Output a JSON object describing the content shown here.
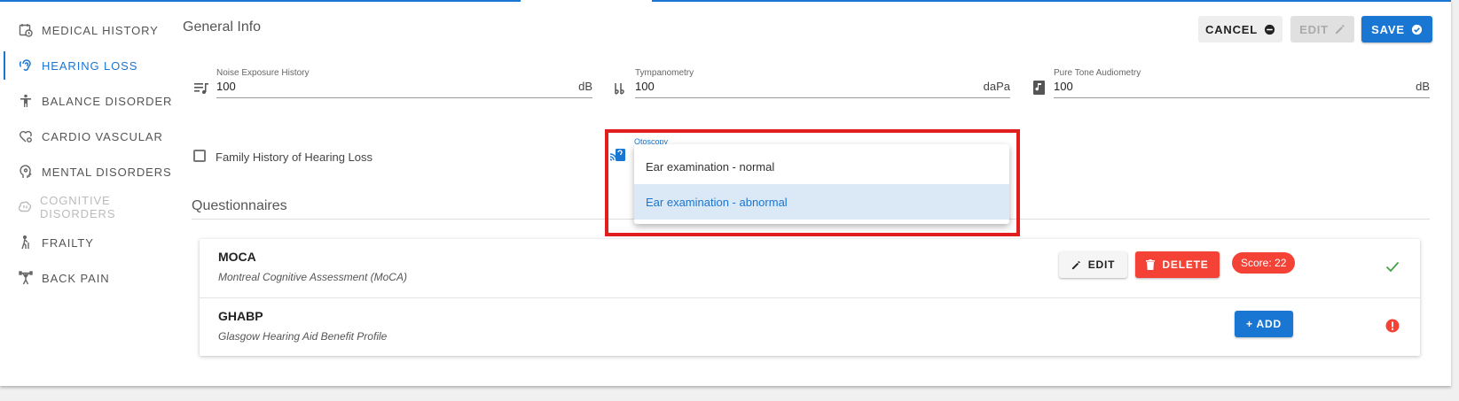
{
  "sidebar": {
    "items": [
      {
        "label": "MEDICAL HISTORY",
        "icon": "calendar-clock-icon",
        "state": "normal"
      },
      {
        "label": "HEARING LOSS",
        "icon": "ear-icon",
        "state": "active"
      },
      {
        "label": "BALANCE DISORDER",
        "icon": "person-standing-icon",
        "state": "normal"
      },
      {
        "label": "CARDIO VASCULAR",
        "icon": "heart-gear-icon",
        "state": "normal"
      },
      {
        "label": "MENTAL DISORDERS",
        "icon": "head-icon",
        "state": "normal"
      },
      {
        "label": "COGNITIVE DISORDERS",
        "icon": "brain-icon",
        "state": "disabled"
      },
      {
        "label": "FRAILTY",
        "icon": "walking-cane-icon",
        "state": "normal"
      },
      {
        "label": "BACK PAIN",
        "icon": "weightlifter-icon",
        "state": "normal"
      }
    ]
  },
  "header": {
    "title": "General Info",
    "cancel_label": "CANCEL",
    "edit_label": "EDIT",
    "save_label": "SAVE"
  },
  "fields": {
    "noise": {
      "label": "Noise Exposure History",
      "value": "100",
      "unit": "dB",
      "icon": "music-list-icon"
    },
    "tympanometry": {
      "label": "Tympanometry",
      "value": "100",
      "unit": "daPa",
      "icon": "double-flat-icon"
    },
    "pure_tone": {
      "label": "Pure Tone Audiometry",
      "value": "100",
      "unit": "dB",
      "icon": "music-book-icon"
    }
  },
  "family_history": {
    "label": "Family History of Hearing Loss",
    "checked": false
  },
  "otoscopy": {
    "label": "Otoscopy",
    "icon": "ear-hearing-icon",
    "options": [
      "Ear examination - normal",
      "Ear examination - abnormal"
    ],
    "highlighted_index": 1
  },
  "questionnaires": {
    "title": "Questionnaires",
    "items": [
      {
        "title": "MOCA",
        "subtitle": "Montreal Cognitive Assessment (MoCA)",
        "edit_label": "EDIT",
        "delete_label": "DELETE",
        "score": "Score: 22",
        "status": "check-icon",
        "status_color": "#43a047"
      },
      {
        "title": "GHABP",
        "subtitle": "Glasgow Hearing Aid Benefit Profile",
        "add_label": "+ ADD",
        "status": "alert-circle-icon",
        "status_color": "#f44336"
      }
    ]
  },
  "colors": {
    "primary": "#1976d2",
    "danger": "#f44336",
    "success": "#43a047",
    "highlight_box": "#e01e1e"
  }
}
